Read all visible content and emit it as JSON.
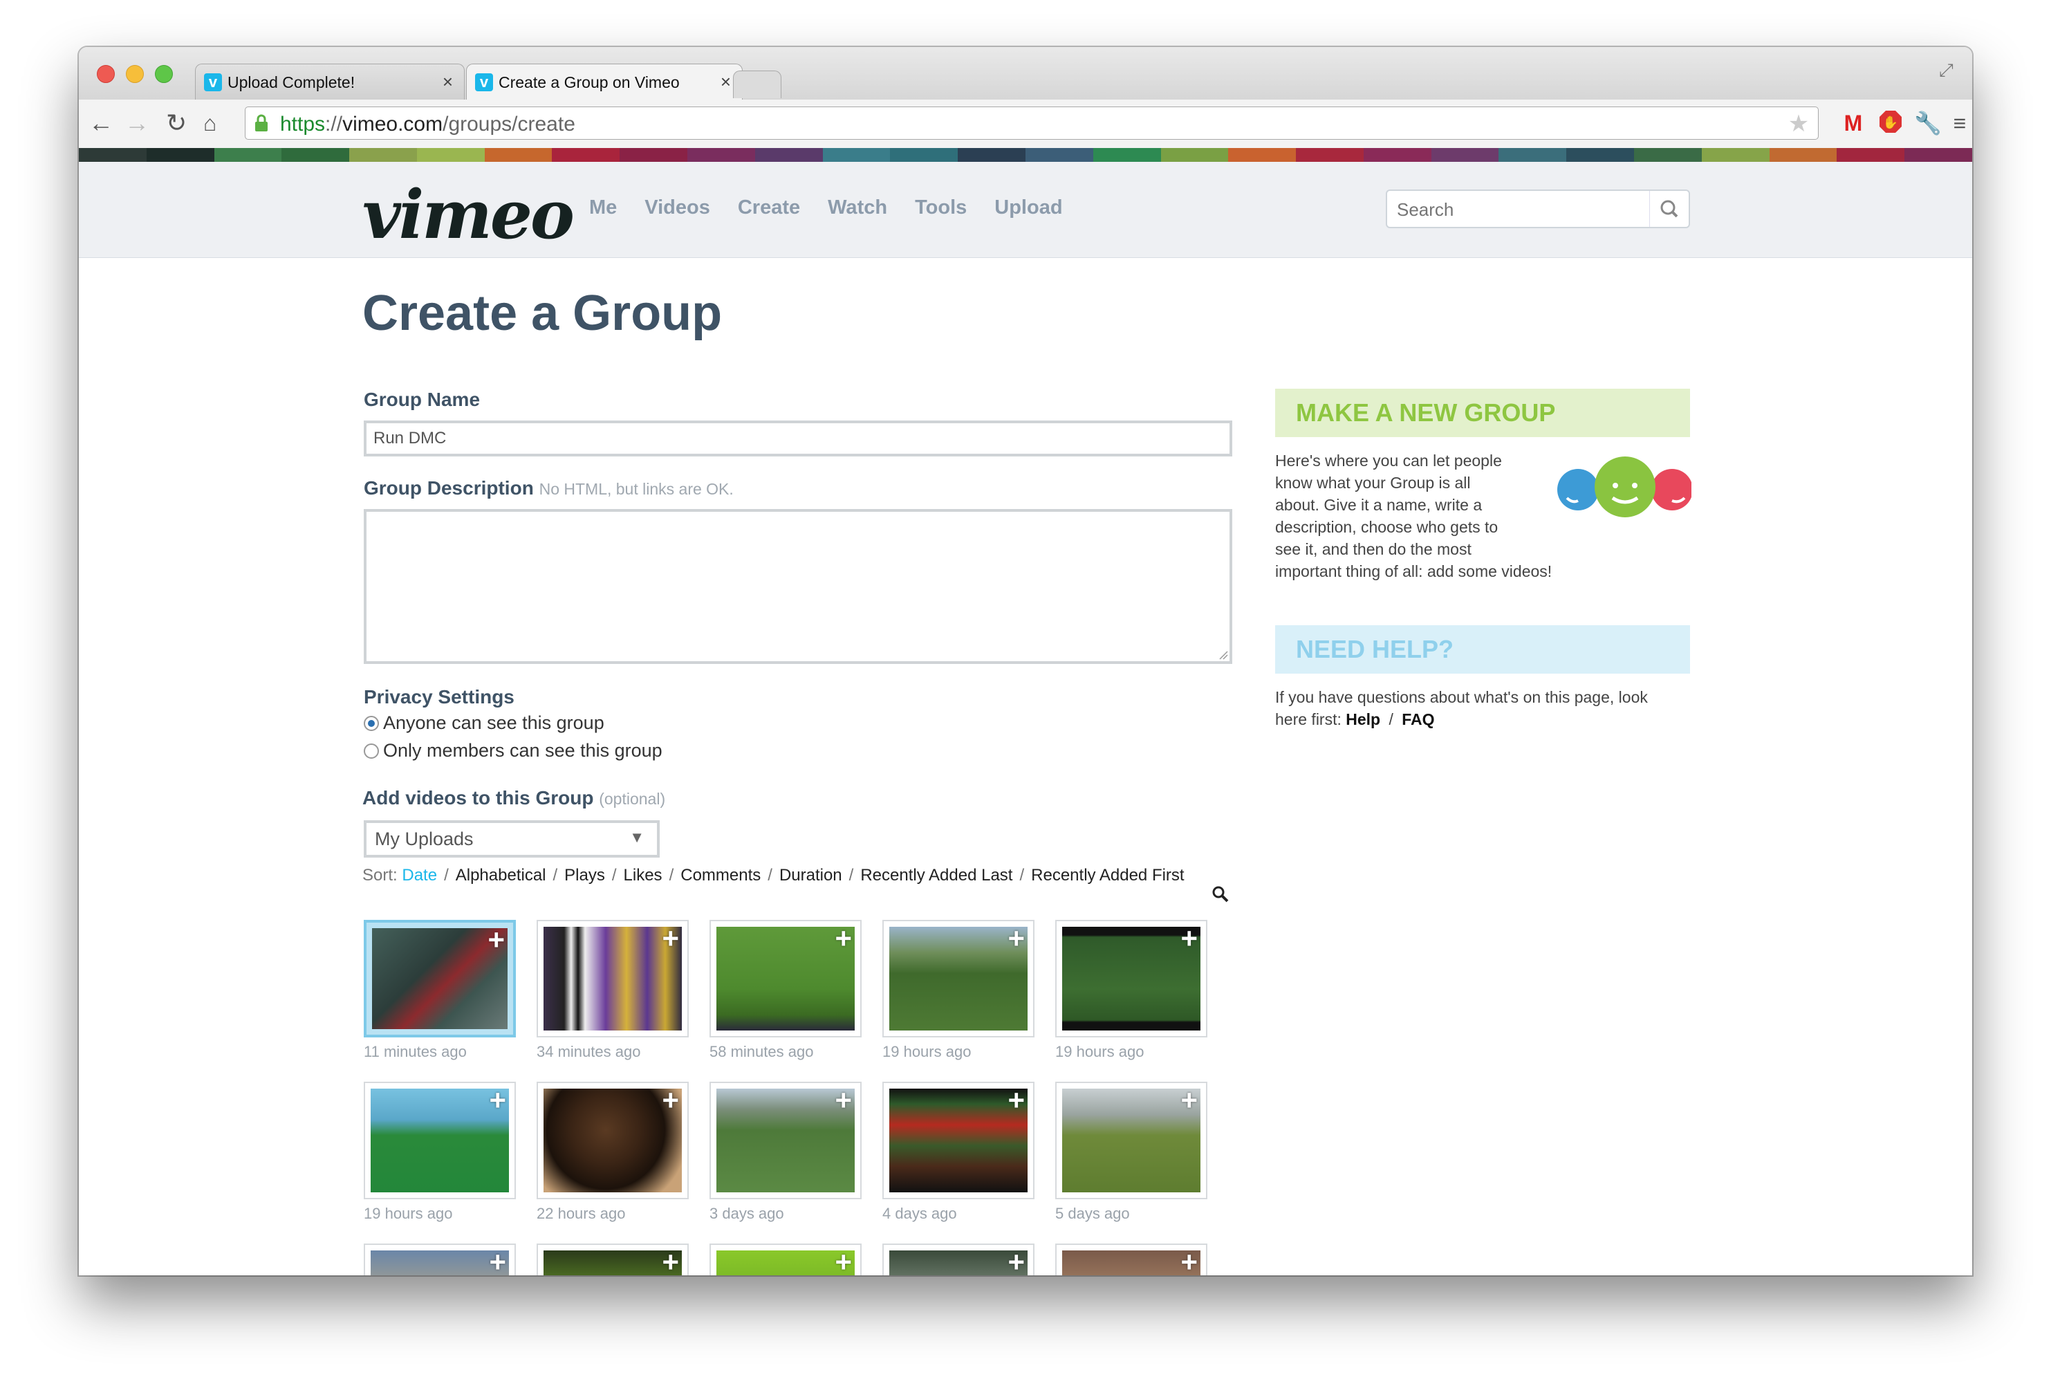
{
  "browser": {
    "tabs": [
      {
        "label": "Upload Complete!",
        "favicon": "vimeo-favicon",
        "active": false
      },
      {
        "label": "Create a Group on Vimeo",
        "favicon": "vimeo-favicon",
        "active": true
      }
    ],
    "address": {
      "scheme": "https",
      "separator": "://",
      "host": "vimeo.com",
      "path": "/groups/create"
    },
    "toolbar_icons": [
      "back-icon",
      "forward-icon",
      "reload-icon",
      "home-icon",
      "bookmark-star-icon",
      "gmail-icon",
      "adblock-icon",
      "wrench-icon",
      "menu-icon"
    ]
  },
  "stripe_colors": [
    "#2d3a37",
    "#1e2d2a",
    "#3d7f4c",
    "#2f6b3c",
    "#8aa14c",
    "#9ab650",
    "#c6672d",
    "#a9243c",
    "#8a2246",
    "#7a2d5e",
    "#5a3a6a",
    "#3a7d8a",
    "#2f6f7a",
    "#2b3f53",
    "#3c5e78",
    "#2d8a52",
    "#7aa044",
    "#c9622f",
    "#a8283d",
    "#8a2a58",
    "#6d3b6b",
    "#3b6e7b",
    "#2c4e5d",
    "#3a6b46",
    "#86a449",
    "#c16a31",
    "#a2263e",
    "#7c2a55"
  ],
  "header": {
    "logo": "vimeo",
    "nav": [
      "Me",
      "Videos",
      "Create",
      "Watch",
      "Tools",
      "Upload"
    ],
    "search_placeholder": "Search"
  },
  "page": {
    "title": "Create a Group",
    "group_name": {
      "label": "Group Name",
      "value": "Run DMC"
    },
    "group_description": {
      "label": "Group Description",
      "hint": "No HTML, but links are OK.",
      "value": ""
    },
    "privacy": {
      "label": "Privacy Settings",
      "options": [
        {
          "label": "Anyone can see this group",
          "checked": true
        },
        {
          "label": "Only members can see this group",
          "checked": false
        }
      ]
    },
    "add_videos": {
      "label": "Add videos to this Group",
      "hint": "(optional)",
      "source": "My Uploads"
    },
    "sort": {
      "label": "Sort:",
      "options": [
        "Date",
        "Alphabetical",
        "Plays",
        "Likes",
        "Comments",
        "Duration",
        "Recently Added Last",
        "Recently Added First"
      ],
      "active": "Date"
    },
    "videos": [
      {
        "time": "11 minutes ago",
        "selected": true
      },
      {
        "time": "34 minutes ago",
        "selected": false
      },
      {
        "time": "58 minutes ago",
        "selected": false
      },
      {
        "time": "19 hours ago",
        "selected": false
      },
      {
        "time": "19 hours ago",
        "selected": false
      },
      {
        "time": "19 hours ago",
        "selected": false
      },
      {
        "time": "22 hours ago",
        "selected": false
      },
      {
        "time": "3 days ago",
        "selected": false
      },
      {
        "time": "4 days ago",
        "selected": false
      },
      {
        "time": "5 days ago",
        "selected": false
      }
    ]
  },
  "sidebar": {
    "make_group": {
      "heading": "MAKE A NEW GROUP",
      "text_lines": [
        "Here's where you can let people",
        "know what your Group is all",
        "about. Give it a name, write a",
        "description, choose who gets to",
        "see it, and then do the most",
        "important thing of all: add some videos!"
      ]
    },
    "help": {
      "heading": "NEED HELP?",
      "line1": "If you have questions about what's on this page, look",
      "line2_prefix": "here first:",
      "help_link": "Help",
      "separator": "/",
      "faq_link": "FAQ"
    }
  }
}
